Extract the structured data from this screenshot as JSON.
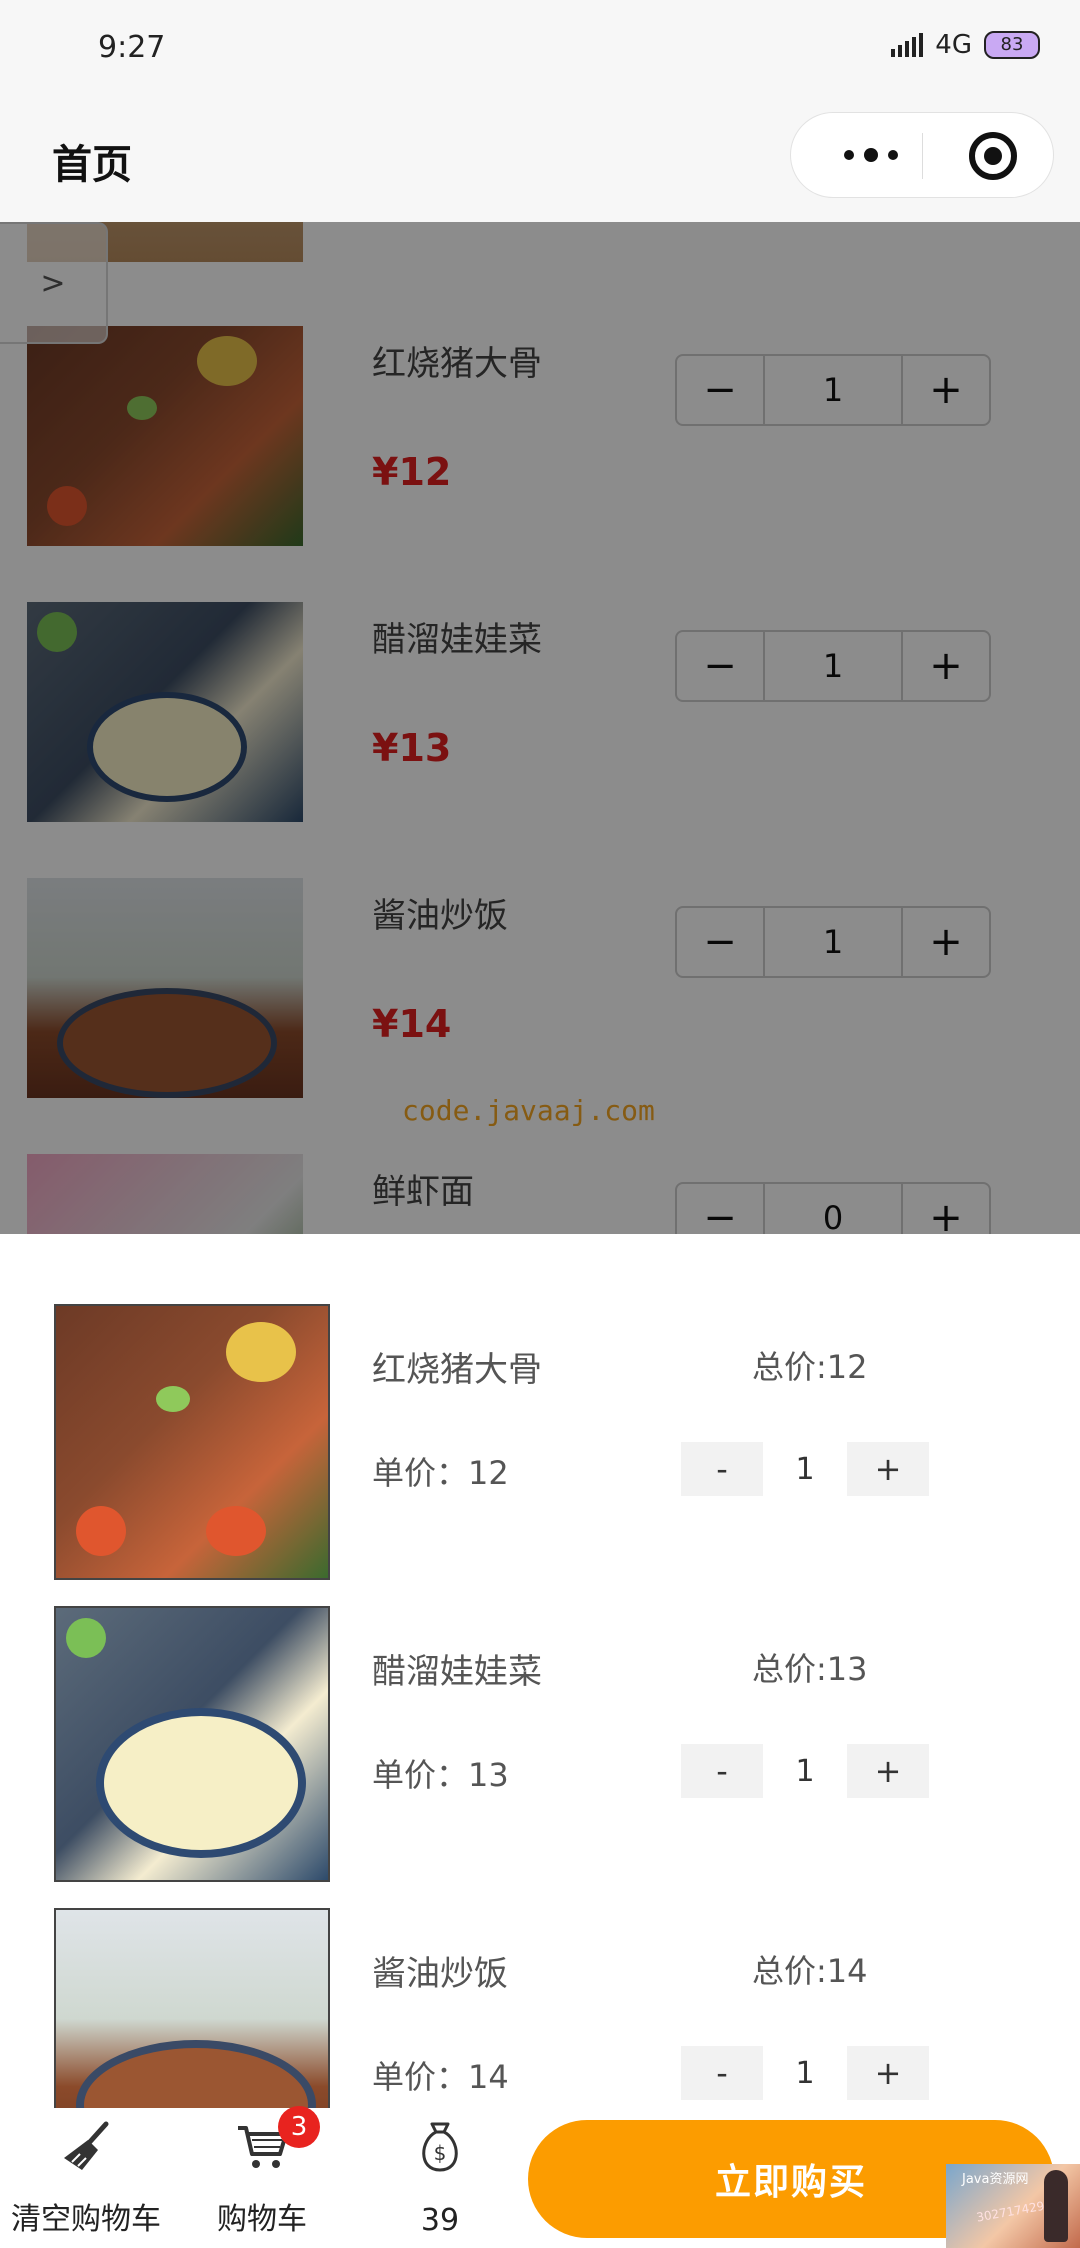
{
  "status_bar": {
    "time": "9:27",
    "network": "4G",
    "battery": "83"
  },
  "header": {
    "title": "首页"
  },
  "side_tab": {
    "label": ">"
  },
  "menu_items": [
    {
      "name": "红烧猪大骨",
      "price": "¥12",
      "count": "1"
    },
    {
      "name": "醋溜娃娃菜",
      "price": "¥13",
      "count": "1"
    },
    {
      "name": "酱油炒饭",
      "price": "¥14",
      "count": "1"
    },
    {
      "name": "鲜虾面",
      "price": "",
      "count": "0"
    }
  ],
  "stepper": {
    "minus": "−",
    "plus": "+"
  },
  "watermark": "code.javaaj.com",
  "cart": {
    "items": [
      {
        "name": "红烧猪大骨",
        "unit_price": "单价：12",
        "total": "总价:12",
        "count": "1"
      },
      {
        "name": "醋溜娃娃菜",
        "unit_price": "单价：13",
        "total": "总价:13",
        "count": "1"
      },
      {
        "name": "酱油炒饭",
        "unit_price": "单价：14",
        "total": "总价:14",
        "count": "1"
      }
    ],
    "minus": "-",
    "plus": "+"
  },
  "bottom_bar": {
    "clear_label": "清空购物车",
    "cart_label": "购物车",
    "cart_badge": "3",
    "total_amount": "39",
    "buy_label": "立即购买"
  },
  "corner_watermark": {
    "line1": "Java资源网",
    "line2": "3027174292"
  }
}
